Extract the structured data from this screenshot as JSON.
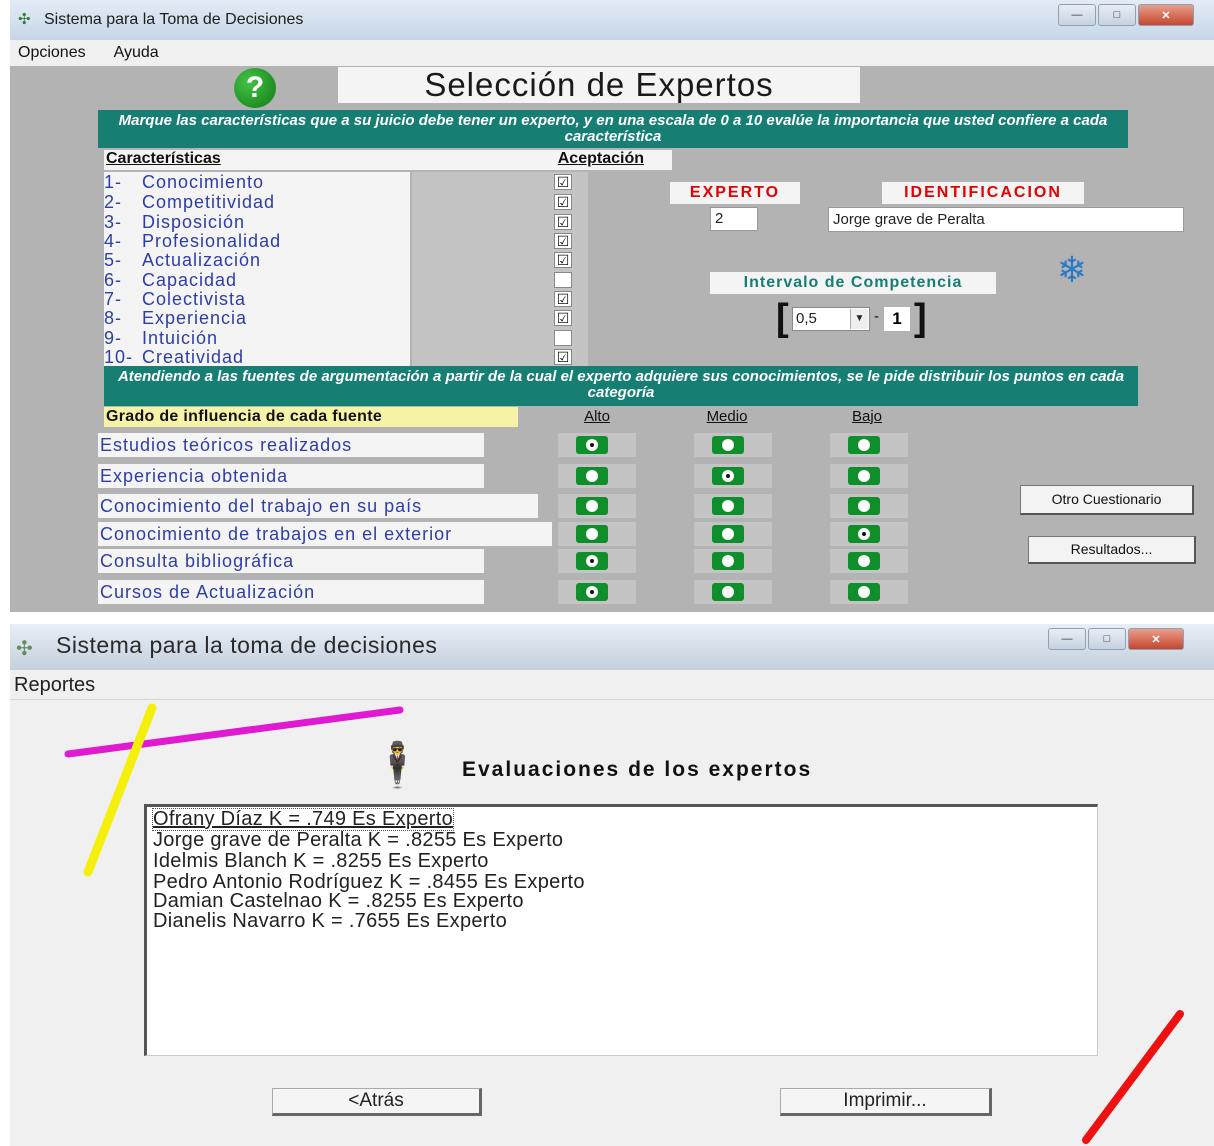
{
  "window1": {
    "title": "Sistema para la Toma de Decisiones",
    "controls": {
      "minimize": "—",
      "maximize": "□",
      "close": "✕"
    },
    "menu": [
      "Opciones",
      "Ayuda"
    ],
    "heading": "Selección de Expertos",
    "instructions": "Marque las características que a su juicio debe tener un experto, y en una escala de 0 a 10 evalúe la importancia que usted confiere a cada característica",
    "characteristics_header": "Características",
    "acceptance_header": "Aceptación",
    "characteristics": [
      {
        "num": "1-",
        "label": "Conocimiento",
        "checked": "☑"
      },
      {
        "num": "2-",
        "label": "Competitividad",
        "checked": "☑"
      },
      {
        "num": "3-",
        "label": "Disposición",
        "checked": "☑"
      },
      {
        "num": "4-",
        "label": "Profesionalidad",
        "checked": "☑"
      },
      {
        "num": "5-",
        "label": "Actualización",
        "checked": "☑"
      },
      {
        "num": "6-",
        "label": "Capacidad",
        "checked": ""
      },
      {
        "num": "7-",
        "label": "Colectivista",
        "checked": "☑"
      },
      {
        "num": "8-",
        "label": "Experiencia",
        "checked": "☑"
      },
      {
        "num": "9-",
        "label": "Intuición",
        "checked": ""
      },
      {
        "num": "10-",
        "label": "Creatividad",
        "checked": "☑"
      }
    ],
    "experto_label": "EXPERTO",
    "experto_value": "2",
    "identificacion_label": "IDENTIFICACION",
    "identificacion_value": "Jorge grave de Peralta",
    "intervalo_label": "Intervalo de Competencia",
    "intervalo_min": "0,5",
    "intervalo_sep": "-",
    "intervalo_max": "1",
    "sources_instructions": "Atendiendo a las fuentes de argumentación a partir de la cual el experto adquiere sus conocimientos, se le pide distribuir los puntos en cada categoría",
    "grado_header": "Grado de influencia de cada fuente",
    "option_headers": [
      "Alto",
      "Medio",
      "Bajo"
    ],
    "sources": [
      {
        "label": "Estudios teóricos realizados",
        "selected": "Alto"
      },
      {
        "label": "Experiencia obtenida",
        "selected": "Medio"
      },
      {
        "label": "Conocimiento del trabajo en su país",
        "selected": ""
      },
      {
        "label": "Conocimiento de trabajos en el exterior",
        "selected": "Bajo"
      },
      {
        "label": "Consulta bibliográfica",
        "selected": "Alto"
      },
      {
        "label": "Cursos de Actualización",
        "selected": "Alto"
      }
    ],
    "buttons": {
      "otro": "Otro Cuestionario",
      "resultados": "Resultados..."
    }
  },
  "window2": {
    "title": "Sistema para la toma de decisiones",
    "controls": {
      "minimize": "—",
      "maximize": "□",
      "close": "✕"
    },
    "menu": [
      "Reportes"
    ],
    "heading": "Evaluaciones de los expertos",
    "evaluations": [
      "Ofrany Díaz      K = .749  Es Experto",
      "Jorge grave de Peralta     K =  .8255  Es Experto",
      "Idelmis Blanch      K =  .8255  Es Experto",
      "Pedro Antonio Rodríguez      K =  .8455  Es Experto",
      "Damian Castelnao      K =  .8255  Es Experto",
      "Dianelis Navarro      K =  .7655  Es Experto"
    ],
    "buttons": {
      "back": "<Atrás",
      "print": "Imprimir..."
    }
  },
  "colors": {
    "window_bg": "#b3b3b3",
    "banner": "#177e74",
    "label_red": "#e60000",
    "text_blue": "#2e3ea8",
    "radio_green": "#0e8f2c",
    "highlight_yellow": "#f7f3a6",
    "annotation_magenta": "#e01ad0",
    "annotation_yellow": "#f4f00c",
    "annotation_red": "#ee1111"
  },
  "icons": {
    "help": "question-circle-icon",
    "snowflake": "snowflake-icon",
    "person": "person-icon",
    "app": "app-logo-icon"
  }
}
